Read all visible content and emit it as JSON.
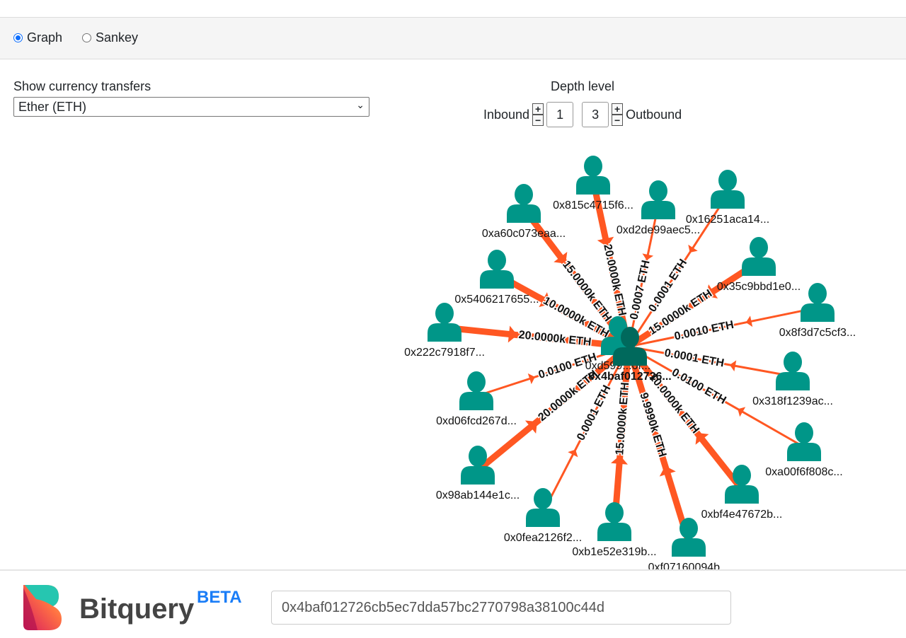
{
  "mode": {
    "options": [
      "Graph",
      "Sankey"
    ],
    "selected": "Graph"
  },
  "currency": {
    "label": "Show currency transfers",
    "value": "Ether (ETH)"
  },
  "depth": {
    "title": "Depth level",
    "inbound_label": "Inbound",
    "inbound": "1",
    "outbound": "3",
    "outbound_label": "Outbound",
    "plus": "+",
    "minus": "−"
  },
  "colors": {
    "edge": "#ff5722",
    "node": "#009688",
    "center_node": "#00695c",
    "accent": "#1a7df7"
  },
  "graph": {
    "center": {
      "address": "0x4baf012726...",
      "icon": "person-icon"
    },
    "secondary": {
      "address": "0xd599...0f..."
    },
    "nodes": [
      {
        "address": "0x815c4715f6...",
        "edge": "20.0000k ETH"
      },
      {
        "address": "0xa60c073eaa...",
        "edge": "15.0000k ETH"
      },
      {
        "address": "0xd2de99aec5...",
        "edge": "0.0007 ETH"
      },
      {
        "address": "0x16251aca14...",
        "edge": "0.0001 ETH"
      },
      {
        "address": "0x5406217655...",
        "edge": "10.0000k ETH"
      },
      {
        "address": "0x35c9bbd1e0...",
        "edge": "15.0000k ETH"
      },
      {
        "address": "0x222c7918f7...",
        "edge": "20.0000k ETH"
      },
      {
        "address": "0x8f3d7c5cf3...",
        "edge": "0.0010 ETH"
      },
      {
        "address": "0x318f1239ac...",
        "edge": "0.0001 ETH"
      },
      {
        "address": "0xd06fcd267d...",
        "edge": "0.0100 ETH"
      },
      {
        "address": "0xa00f6f808c...",
        "edge": "0.0100 ETH"
      },
      {
        "address": "0x98ab144e1c...",
        "edge": "20.0000k ETH"
      },
      {
        "address": "0xbf4e47672b...",
        "edge": "10.0000k ETH"
      },
      {
        "address": "0x0fea2126f2...",
        "edge": "0.0001 ETH"
      },
      {
        "address": "0xb1e52e319b...",
        "edge": "15.0000k ETH"
      },
      {
        "address": "0xf07160094b...",
        "edge": "9.9990k ETH"
      }
    ]
  },
  "footer": {
    "brand": "Bitquery",
    "badge": "BETA",
    "address_value": "0x4baf012726cb5ec7dda57bc2770798a38100c44d"
  }
}
